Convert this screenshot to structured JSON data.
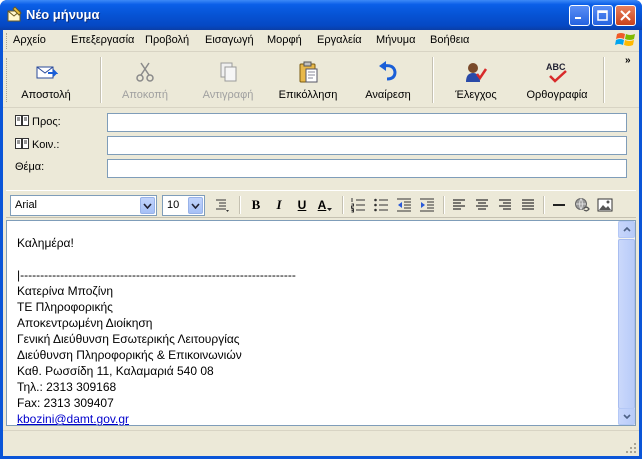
{
  "window": {
    "title": "Νέο μήνυμα"
  },
  "menu": {
    "items": [
      "Αρχείο",
      "Επεξεργασία",
      "Προβολή",
      "Εισαγωγή",
      "Μορφή",
      "Εργαλεία",
      "Μήνυμα",
      "Βοήθεια"
    ]
  },
  "toolbar": {
    "send": "Αποστολή",
    "cut": "Αποκοπή",
    "copy": "Αντιγραφή",
    "paste": "Επικόλληση",
    "undo": "Αναίρεση",
    "check": "Έλεγχος",
    "spelling": "Ορθογραφία",
    "spelling_icon_text": "ABC"
  },
  "header": {
    "to_label": "Προς:",
    "cc_label": "Κοιν.:",
    "subject_label": "Θέμα:",
    "to_value": "",
    "cc_value": "",
    "subject_value": ""
  },
  "format": {
    "font": "Arial",
    "size": "10",
    "bold": "B",
    "italic": "I",
    "underline": "U",
    "color": "A"
  },
  "body": {
    "lines": [
      "Καλημέρα!",
      "",
      "|---------------------------------------------------------------------",
      "Κατερίνα Μποζίνη",
      "ΤΕ Πληροφορικής",
      "Αποκεντρωμένη Διοίκηση",
      "Γενική Διεύθυνση Εσωτερικής Λειτουργίας",
      "Διεύθυνση Πληροφορικής & Επικοινωνιών",
      "Καθ. Ρωσσίδη 11, Καλαμαριά 540 08",
      "Τηλ.: 2313 309168",
      "Fax: 2313 309407"
    ],
    "email": "kbozini@damt.gov.gr"
  }
}
